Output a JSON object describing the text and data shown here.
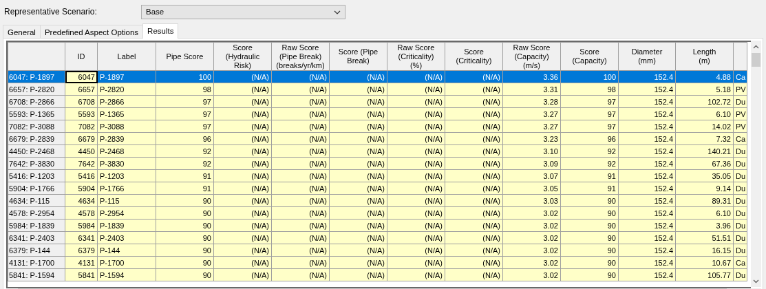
{
  "scenario": {
    "label": "Representative Scenario:",
    "value": "Base"
  },
  "tabs": [
    {
      "label": "General",
      "selected": false
    },
    {
      "label": "Predefined Aspect Options",
      "selected": false
    },
    {
      "label": "Results",
      "selected": true
    }
  ],
  "table": {
    "columns": [
      "ID",
      "Label",
      "Pipe Score",
      "Score\n(Hydraulic\nRisk)",
      "Raw Score\n(Pipe Break)\n(breaks/yr/km)",
      "Score (Pipe\nBreak)",
      "Raw Score\n(Criticality)\n(%)",
      "Score\n(Criticality)",
      "Raw Score\n(Capacity)\n(m/s)",
      "Score\n(Capacity)",
      "Diameter\n(mm)",
      "Length\n(m)"
    ],
    "rows": [
      {
        "header": "6047: P-1897",
        "selected": true,
        "focused": true,
        "cells": [
          "6047",
          "P-1897",
          "100",
          "(N/A)",
          "(N/A)",
          "(N/A)",
          "(N/A)",
          "(N/A)",
          "3.36",
          "100",
          "152.4",
          "4.88",
          "Ca"
        ]
      },
      {
        "header": "6657: P-2820",
        "selected": false,
        "focused": false,
        "cells": [
          "6657",
          "P-2820",
          "98",
          "(N/A)",
          "(N/A)",
          "(N/A)",
          "(N/A)",
          "(N/A)",
          "3.31",
          "98",
          "152.4",
          "5.18",
          "PV"
        ]
      },
      {
        "header": "6708: P-2866",
        "selected": false,
        "focused": false,
        "cells": [
          "6708",
          "P-2866",
          "97",
          "(N/A)",
          "(N/A)",
          "(N/A)",
          "(N/A)",
          "(N/A)",
          "3.28",
          "97",
          "152.4",
          "102.72",
          "Du"
        ]
      },
      {
        "header": "5593: P-1365",
        "selected": false,
        "focused": false,
        "cells": [
          "5593",
          "P-1365",
          "97",
          "(N/A)",
          "(N/A)",
          "(N/A)",
          "(N/A)",
          "(N/A)",
          "3.27",
          "97",
          "152.4",
          "6.10",
          "PV"
        ]
      },
      {
        "header": "7082: P-3088",
        "selected": false,
        "focused": false,
        "cells": [
          "7082",
          "P-3088",
          "97",
          "(N/A)",
          "(N/A)",
          "(N/A)",
          "(N/A)",
          "(N/A)",
          "3.27",
          "97",
          "152.4",
          "14.02",
          "PV"
        ]
      },
      {
        "header": "6679: P-2839",
        "selected": false,
        "focused": false,
        "cells": [
          "6679",
          "P-2839",
          "96",
          "(N/A)",
          "(N/A)",
          "(N/A)",
          "(N/A)",
          "(N/A)",
          "3.23",
          "96",
          "152.4",
          "7.32",
          "Ca"
        ]
      },
      {
        "header": "4450: P-2468",
        "selected": false,
        "focused": false,
        "cells": [
          "4450",
          "P-2468",
          "92",
          "(N/A)",
          "(N/A)",
          "(N/A)",
          "(N/A)",
          "(N/A)",
          "3.10",
          "92",
          "152.4",
          "140.21",
          "Du"
        ]
      },
      {
        "header": "7642: P-3830",
        "selected": false,
        "focused": false,
        "cells": [
          "7642",
          "P-3830",
          "92",
          "(N/A)",
          "(N/A)",
          "(N/A)",
          "(N/A)",
          "(N/A)",
          "3.09",
          "92",
          "152.4",
          "67.36",
          "Du"
        ]
      },
      {
        "header": "5416: P-1203",
        "selected": false,
        "focused": false,
        "cells": [
          "5416",
          "P-1203",
          "91",
          "(N/A)",
          "(N/A)",
          "(N/A)",
          "(N/A)",
          "(N/A)",
          "3.07",
          "91",
          "152.4",
          "35.05",
          "Du"
        ]
      },
      {
        "header": "5904: P-1766",
        "selected": false,
        "focused": false,
        "cells": [
          "5904",
          "P-1766",
          "91",
          "(N/A)",
          "(N/A)",
          "(N/A)",
          "(N/A)",
          "(N/A)",
          "3.05",
          "91",
          "152.4",
          "9.14",
          "Du"
        ]
      },
      {
        "header": "4634: P-115",
        "selected": false,
        "focused": false,
        "cells": [
          "4634",
          "P-115",
          "90",
          "(N/A)",
          "(N/A)",
          "(N/A)",
          "(N/A)",
          "(N/A)",
          "3.03",
          "90",
          "152.4",
          "89.31",
          "Du"
        ]
      },
      {
        "header": "4578: P-2954",
        "selected": false,
        "focused": false,
        "cells": [
          "4578",
          "P-2954",
          "90",
          "(N/A)",
          "(N/A)",
          "(N/A)",
          "(N/A)",
          "(N/A)",
          "3.02",
          "90",
          "152.4",
          "6.10",
          "Du"
        ]
      },
      {
        "header": "5984: P-1839",
        "selected": false,
        "focused": false,
        "cells": [
          "5984",
          "P-1839",
          "90",
          "(N/A)",
          "(N/A)",
          "(N/A)",
          "(N/A)",
          "(N/A)",
          "3.02",
          "90",
          "152.4",
          "3.96",
          "Du"
        ]
      },
      {
        "header": "6341: P-2403",
        "selected": false,
        "focused": false,
        "cells": [
          "6341",
          "P-2403",
          "90",
          "(N/A)",
          "(N/A)",
          "(N/A)",
          "(N/A)",
          "(N/A)",
          "3.02",
          "90",
          "152.4",
          "51.51",
          "Du"
        ]
      },
      {
        "header": "6379: P-144",
        "selected": false,
        "focused": false,
        "cells": [
          "6379",
          "P-144",
          "90",
          "(N/A)",
          "(N/A)",
          "(N/A)",
          "(N/A)",
          "(N/A)",
          "3.02",
          "90",
          "152.4",
          "16.15",
          "Du"
        ]
      },
      {
        "header": "4131: P-1700",
        "selected": false,
        "focused": false,
        "cells": [
          "4131",
          "P-1700",
          "90",
          "(N/A)",
          "(N/A)",
          "(N/A)",
          "(N/A)",
          "(N/A)",
          "3.02",
          "90",
          "152.4",
          "10.67",
          "Ca"
        ]
      },
      {
        "header": "5841: P-1594",
        "selected": false,
        "focused": false,
        "cells": [
          "5841",
          "P-1594",
          "90",
          "(N/A)",
          "(N/A)",
          "(N/A)",
          "(N/A)",
          "(N/A)",
          "3.02",
          "90",
          "152.4",
          "105.77",
          "Du"
        ]
      }
    ]
  }
}
